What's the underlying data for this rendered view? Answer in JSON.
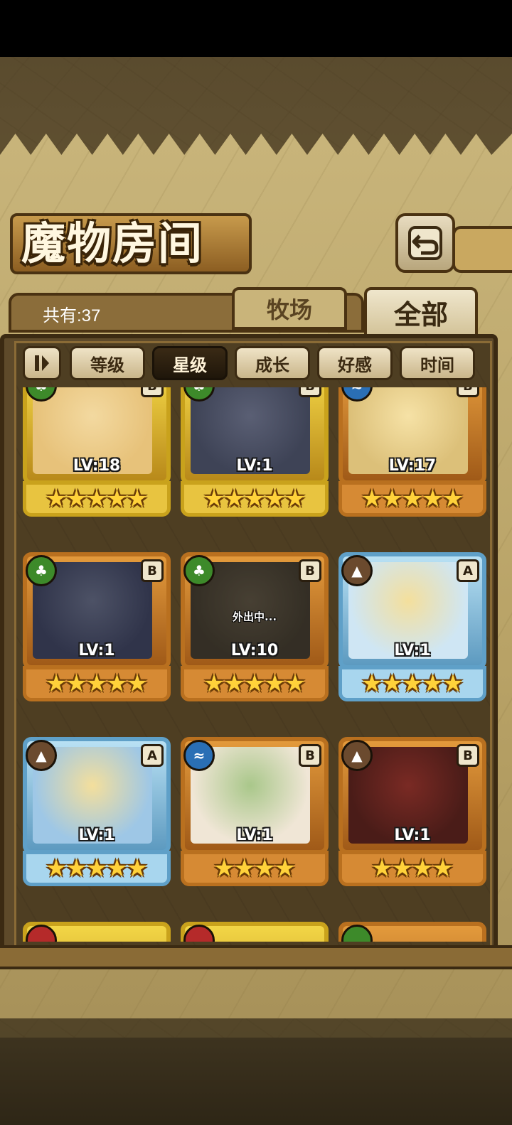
{
  "header": {
    "title": "魔物房间",
    "back_icon": "return-arrow-icon"
  },
  "info": {
    "count_label": "共有:37"
  },
  "tabs": [
    {
      "label": "牧场",
      "active": false
    },
    {
      "label": "全部",
      "active": true
    }
  ],
  "sort": {
    "toggle_icon": "sort-order-icon",
    "buttons": [
      {
        "label": "等级",
        "active": false
      },
      {
        "label": "星级",
        "active": true
      },
      {
        "label": "成长",
        "active": false
      },
      {
        "label": "好感",
        "active": false
      },
      {
        "label": "时间",
        "active": false
      }
    ]
  },
  "monsters": [
    {
      "level": "LV:18",
      "stars": 5,
      "frame": "gold",
      "element": "wood",
      "grade": "B",
      "status": ""
    },
    {
      "level": "LV:1",
      "stars": 5,
      "frame": "gold",
      "element": "wood",
      "grade": "B",
      "status": ""
    },
    {
      "level": "LV:17",
      "stars": 5,
      "frame": "bronze",
      "element": "water",
      "grade": "B",
      "status": ""
    },
    {
      "level": "LV:1",
      "stars": 5,
      "frame": "bronze",
      "element": "wood",
      "grade": "B",
      "status": ""
    },
    {
      "level": "LV:10",
      "stars": 5,
      "frame": "bronze",
      "element": "wood",
      "grade": "B",
      "status": "外出中..."
    },
    {
      "level": "LV:1",
      "stars": 5,
      "frame": "ice",
      "element": "earth",
      "grade": "A",
      "status": ""
    },
    {
      "level": "LV:1",
      "stars": 5,
      "frame": "ice",
      "element": "earth",
      "grade": "A",
      "status": ""
    },
    {
      "level": "LV:1",
      "stars": 4,
      "frame": "bronze",
      "element": "water",
      "grade": "B",
      "status": ""
    },
    {
      "level": "LV:1",
      "stars": 4,
      "frame": "bronze",
      "element": "earth",
      "grade": "B",
      "status": ""
    }
  ],
  "colors": {
    "wood": "#3d8a2a",
    "water": "#2a6fb5",
    "earth": "#6b4a2e",
    "fire": "#b52a2a"
  }
}
